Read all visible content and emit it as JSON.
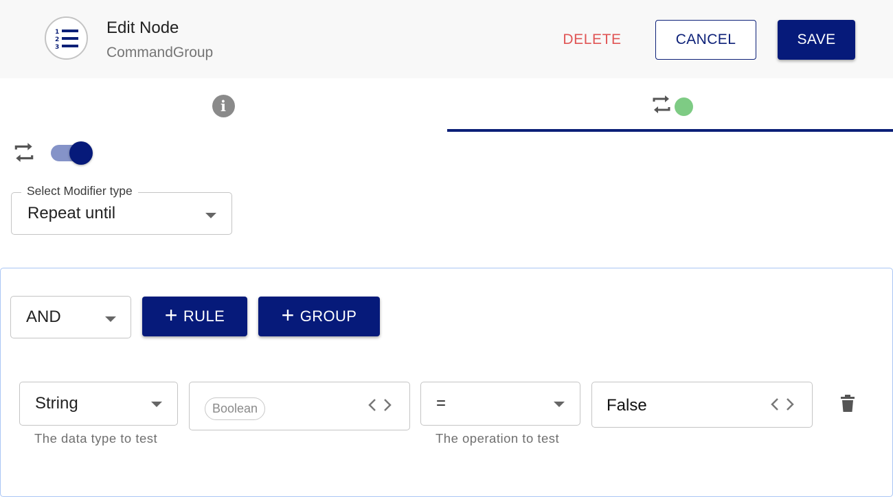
{
  "header": {
    "icon": "format-list-numbered-icon",
    "title": "Edit Node",
    "subtitle": "CommandGroup",
    "delete_label": "DELETE",
    "cancel_label": "CANCEL",
    "save_label": "SAVE"
  },
  "tabs": [
    {
      "icon": "info-icon",
      "active": false
    },
    {
      "icon": "repeat-icon",
      "status_dot": "green",
      "active": true
    }
  ],
  "modifier": {
    "toggle_icon": "repeat-icon",
    "enabled": true,
    "select_label": "Select Modifier type",
    "select_value": "Repeat until"
  },
  "query": {
    "combinator": "AND",
    "add_rule_label": "RULE",
    "add_group_label": "GROUP",
    "rule": {
      "data_type": "String",
      "data_type_helper": "The data type to test",
      "left_chip": "Boolean",
      "operator": "=",
      "operator_helper": "The operation to test",
      "right_value": "False"
    }
  },
  "colors": {
    "primary": "#061a7a",
    "danger": "#e05555",
    "status_dot": "#7ecb84",
    "query_border": "#a9c5f4"
  }
}
